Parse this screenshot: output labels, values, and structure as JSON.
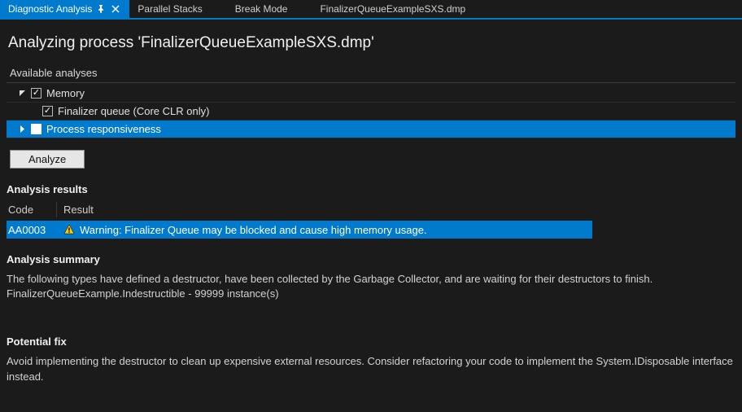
{
  "tabs": {
    "active": "Diagnostic Analysis",
    "others": [
      "Parallel Stacks",
      "Break Mode",
      "FinalizerQueueExampleSXS.dmp"
    ]
  },
  "page_title": "Analyzing process 'FinalizerQueueExampleSXS.dmp'",
  "available_label": "Available analyses",
  "tree": {
    "memory": {
      "label": "Memory",
      "checked": true,
      "expanded": true
    },
    "finalizer": {
      "label": "Finalizer queue (Core CLR only)",
      "checked": true
    },
    "responsiveness": {
      "label": "Process responsiveness",
      "checked": false,
      "selected": true
    }
  },
  "analyze_button": "Analyze",
  "results": {
    "heading": "Analysis results",
    "col_code": "Code",
    "col_result": "Result",
    "rows": [
      {
        "code": "AA0003",
        "icon": "warning",
        "text": "Warning: Finalizer Queue may be blocked and cause high memory usage."
      }
    ]
  },
  "summary": {
    "heading": "Analysis summary",
    "line1": "The following types have defined a destructor, have been collected by the Garbage Collector, and are waiting for their destructors to finish.",
    "line2": "FinalizerQueueExample.Indestructible - 99999 instance(s)"
  },
  "fix": {
    "heading": "Potential fix",
    "text": "Avoid implementing the destructor to clean up expensive external resources. Consider refactoring your code to implement the System.IDisposable interface instead."
  }
}
